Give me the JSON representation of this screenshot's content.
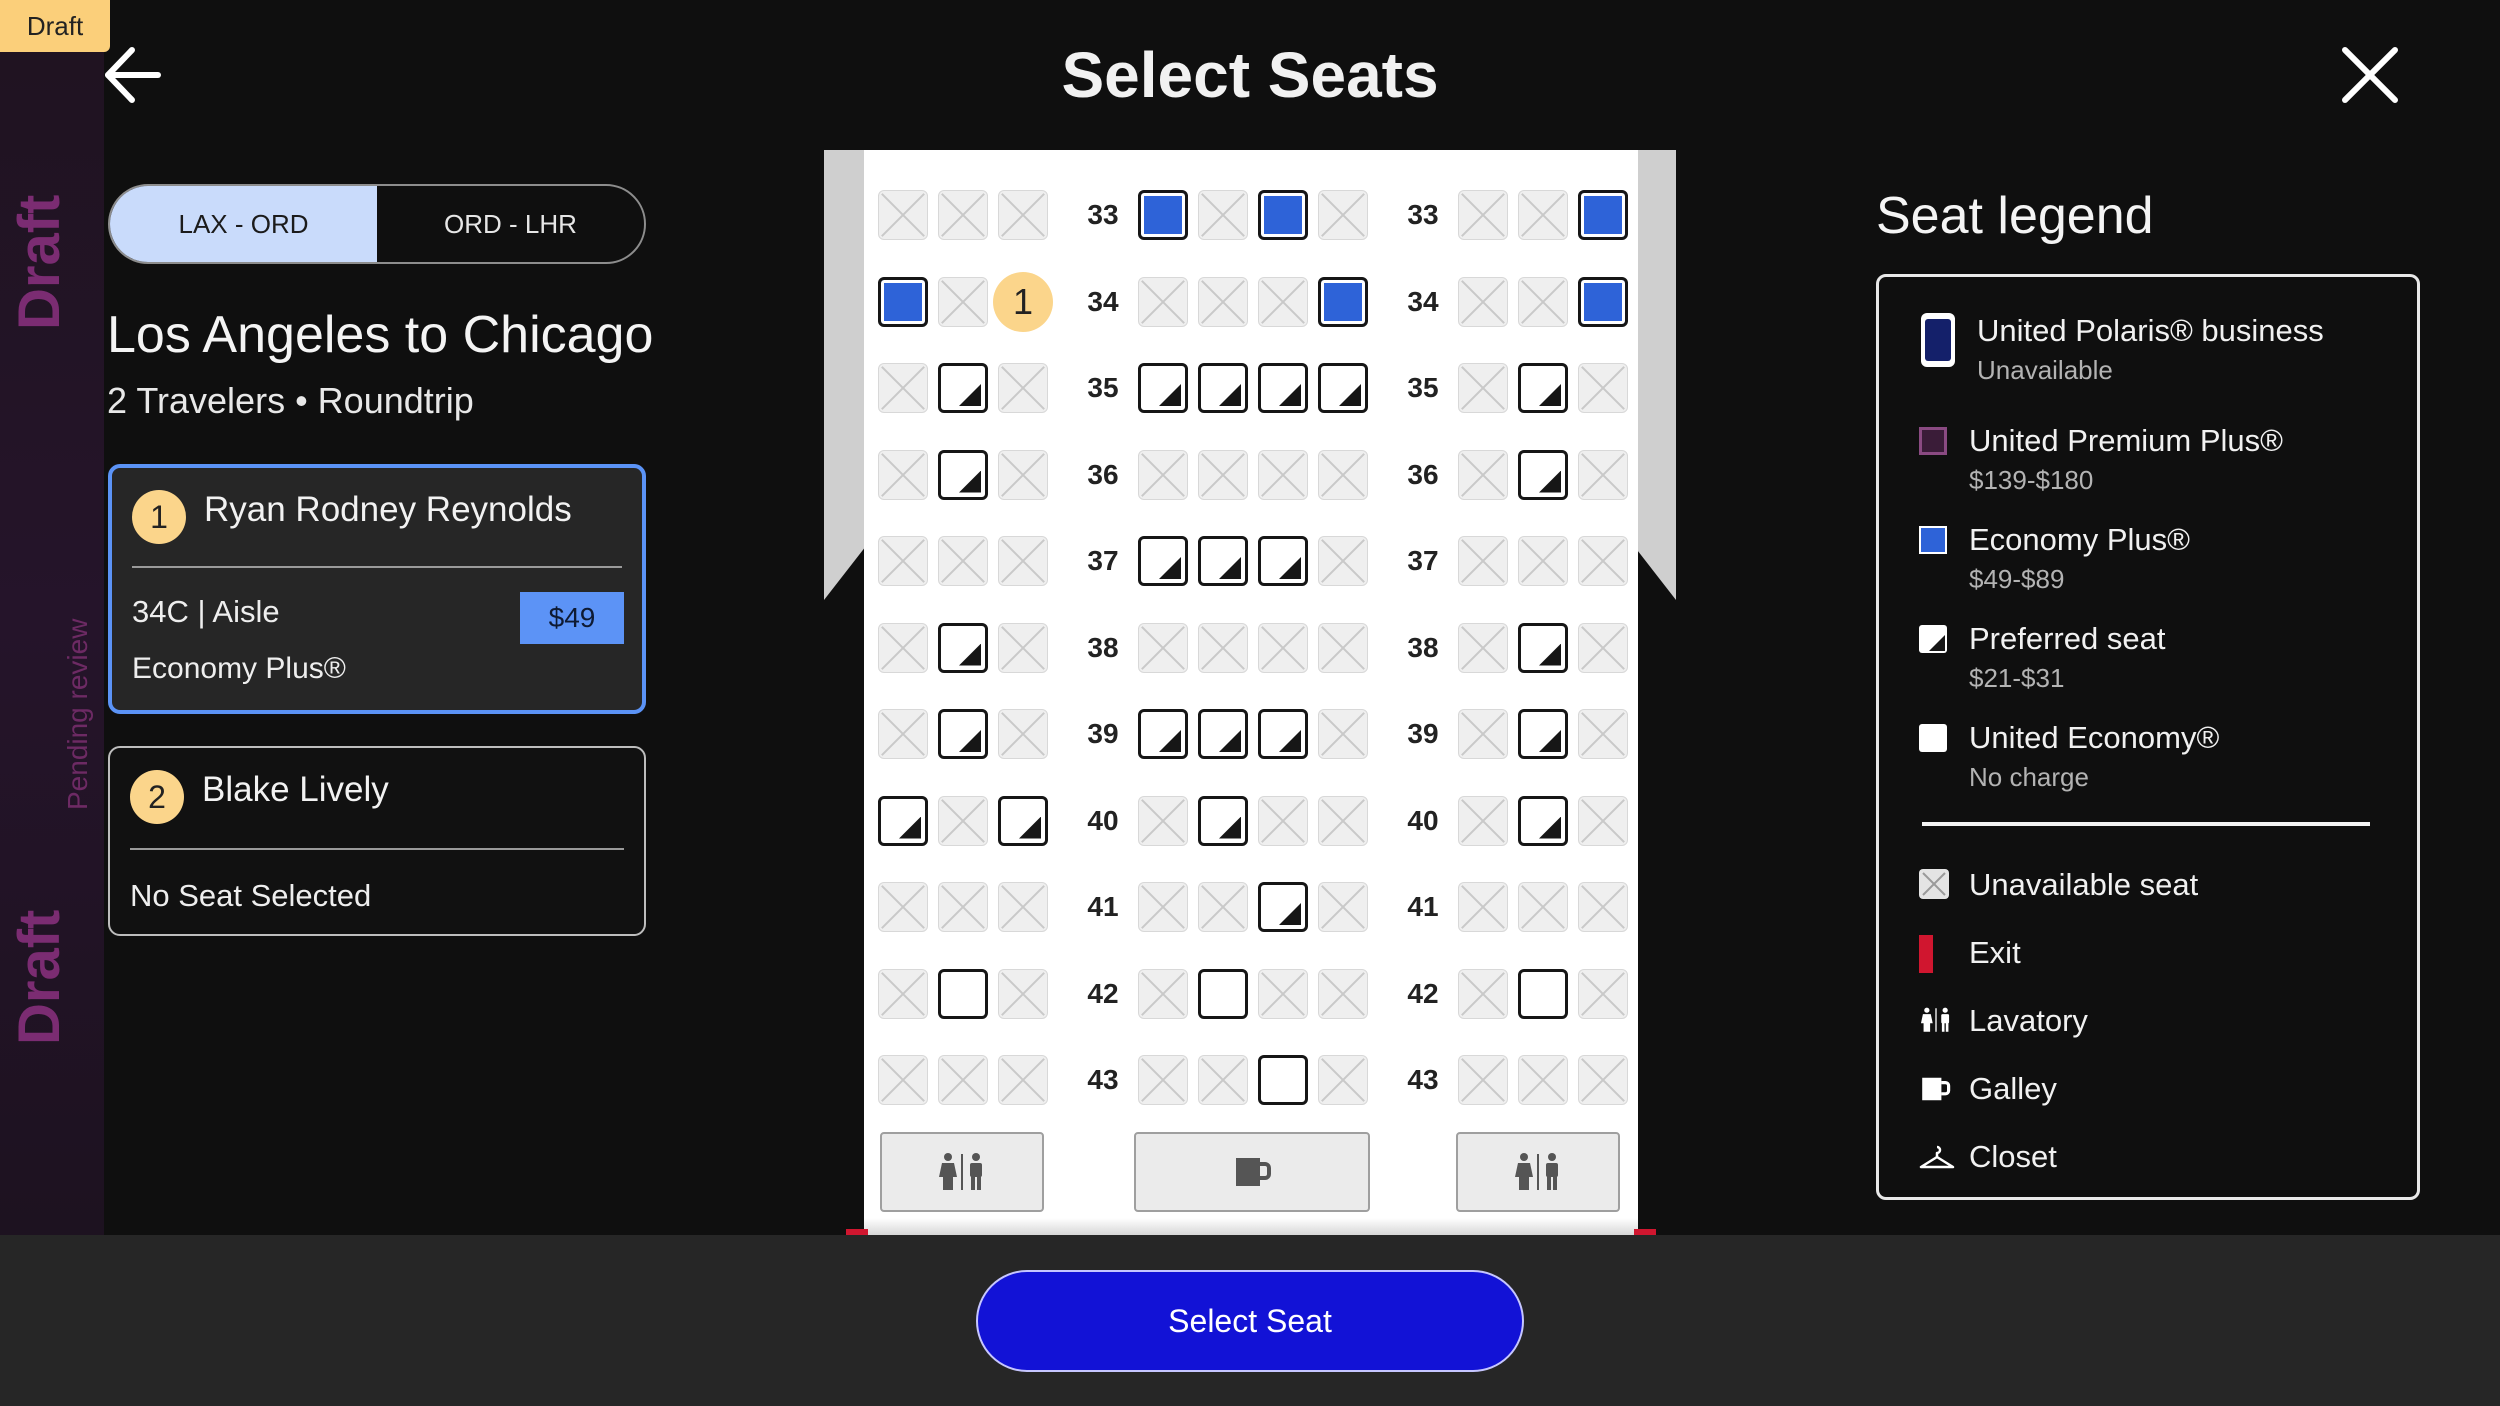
{
  "watermark": {
    "badge": "Draft",
    "vertical_1": "Draft",
    "vertical_2": "Pending review",
    "vertical_3": "Draft"
  },
  "header": {
    "title": "Select Seats",
    "back_icon": "arrow-left-icon",
    "close_icon": "close-icon"
  },
  "flight_tabs": [
    {
      "label": "LAX - ORD",
      "active": true
    },
    {
      "label": "ORD - LHR",
      "active": false
    }
  ],
  "route": {
    "title": "Los Angeles to Chicago",
    "subtitle": "2 Travelers • Roundtrip"
  },
  "travelers": [
    {
      "number": "1",
      "name": "Ryan Rodney Reynolds",
      "seat": "34C | Aisle",
      "cabin": "Economy Plus®",
      "price": "$49",
      "selected": true
    },
    {
      "number": "2",
      "name": "Blake Lively",
      "status": "No Seat Selected",
      "selected": false
    }
  ],
  "seat_map": {
    "rows": [
      {
        "num": "33",
        "seats": [
          "U",
          "U",
          "U",
          "E",
          "U",
          "E",
          "U",
          "U",
          "U",
          "E"
        ]
      },
      {
        "num": "34",
        "seats": [
          "E",
          "U",
          "S",
          "U",
          "U",
          "U",
          "E",
          "U",
          "U",
          "E"
        ]
      },
      {
        "num": "35",
        "seats": [
          "U",
          "P",
          "U",
          "P",
          "P",
          "P",
          "P",
          "U",
          "P",
          "U"
        ]
      },
      {
        "num": "36",
        "seats": [
          "U",
          "P",
          "U",
          "U",
          "U",
          "U",
          "U",
          "U",
          "P",
          "U"
        ]
      },
      {
        "num": "37",
        "seats": [
          "U",
          "U",
          "U",
          "P",
          "P",
          "P",
          "U",
          "U",
          "U",
          "U"
        ]
      },
      {
        "num": "38",
        "seats": [
          "U",
          "P",
          "U",
          "U",
          "U",
          "U",
          "U",
          "U",
          "P",
          "U"
        ]
      },
      {
        "num": "39",
        "seats": [
          "U",
          "P",
          "U",
          "P",
          "P",
          "P",
          "U",
          "U",
          "P",
          "U"
        ]
      },
      {
        "num": "40",
        "seats": [
          "P",
          "U",
          "P",
          "U",
          "P",
          "U",
          "U",
          "U",
          "P",
          "U"
        ]
      },
      {
        "num": "41",
        "seats": [
          "U",
          "U",
          "U",
          "U",
          "U",
          "P",
          "U",
          "U",
          "U",
          "U"
        ]
      },
      {
        "num": "42",
        "seats": [
          "U",
          "N",
          "U",
          "U",
          "N",
          "U",
          "U",
          "U",
          "N",
          "U"
        ]
      },
      {
        "num": "43",
        "seats": [
          "U",
          "U",
          "U",
          "U",
          "U",
          "N",
          "U",
          "U",
          "U",
          "U"
        ]
      }
    ],
    "selected_marker": "1",
    "facilities": [
      "lavatory-icon",
      "galley-icon",
      "lavatory-icon"
    ]
  },
  "legend": {
    "title": "Seat legend",
    "items": [
      {
        "label": "United Polaris® business",
        "sub": "Unavailable",
        "color": "#1a2a6c"
      },
      {
        "label": "United Premium Plus®",
        "sub": "$139-$180",
        "color": "#5a2a52"
      },
      {
        "label": "Economy Plus®",
        "sub": "$49-$89",
        "color": "#2e63d8"
      },
      {
        "label": "Preferred seat",
        "sub": "$21-$31",
        "color": "#ffffff"
      },
      {
        "label": "United Economy®",
        "sub": "No charge",
        "color": "#ffffff"
      }
    ],
    "symbols": [
      {
        "label": "Unavailable seat",
        "icon": "unavailable-seat-icon"
      },
      {
        "label": "Exit",
        "icon": "exit-icon",
        "color": "#d0162f"
      },
      {
        "label": "Lavatory",
        "icon": "lavatory-icon"
      },
      {
        "label": "Galley",
        "icon": "galley-icon"
      },
      {
        "label": "Closet",
        "icon": "closet-icon"
      }
    ]
  },
  "footer": {
    "select_label": "Select Seat",
    "button_color": "#1212d6"
  }
}
